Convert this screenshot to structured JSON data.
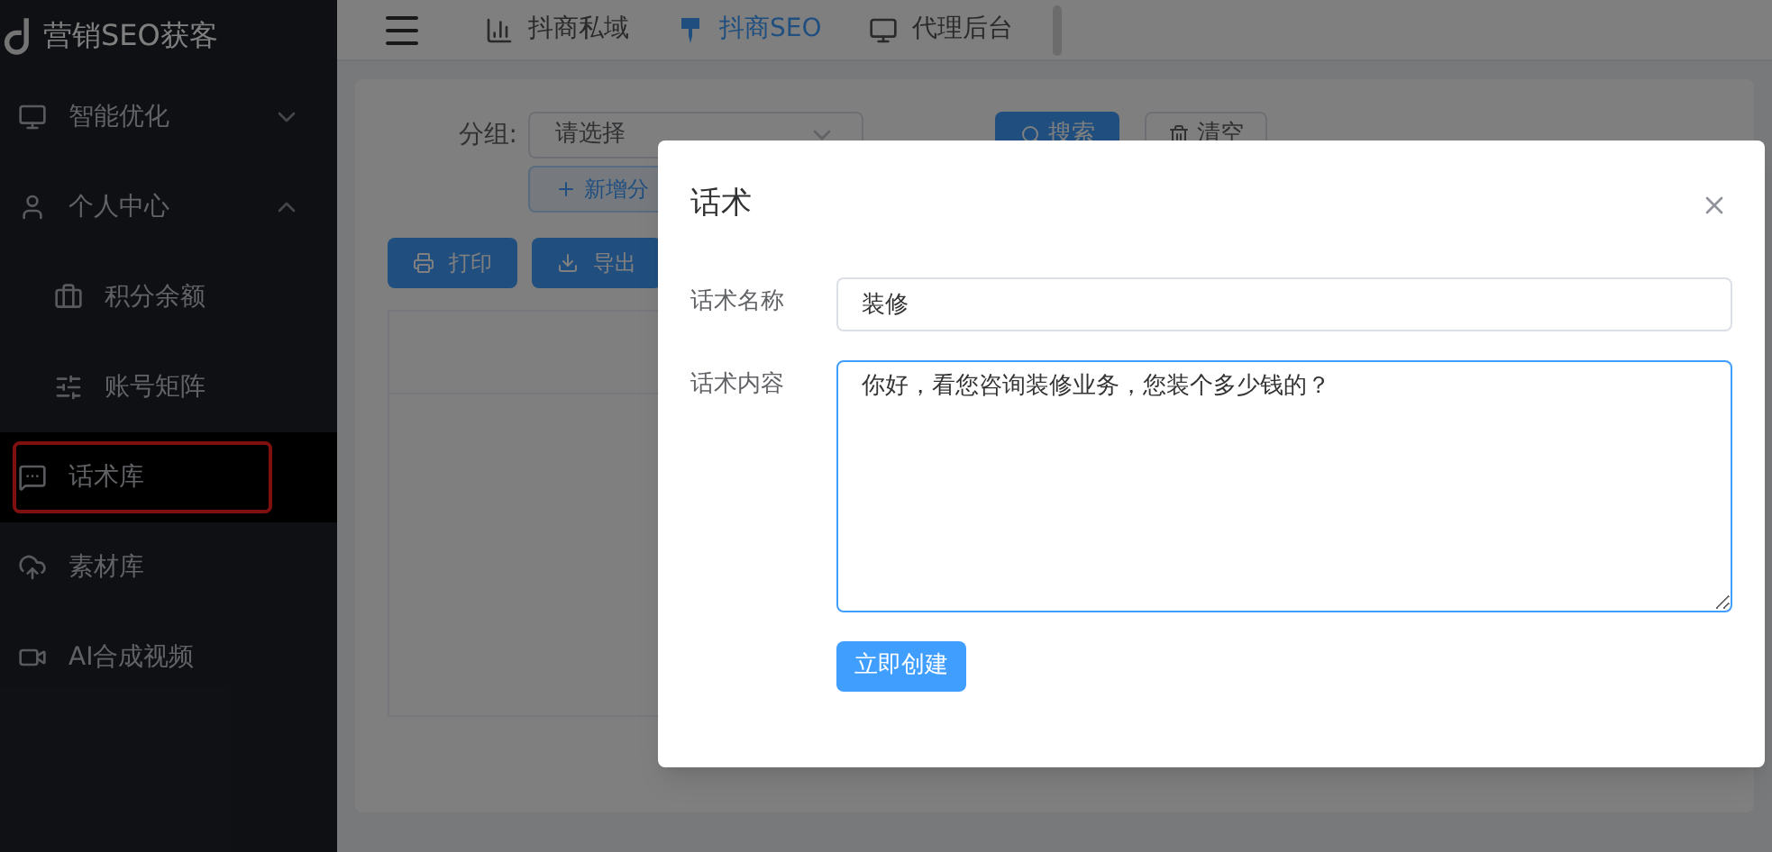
{
  "logo": {
    "text": "营销SEO获客"
  },
  "sidebar": {
    "items": [
      {
        "kind": "group",
        "label": "智能优化",
        "expanded": false
      },
      {
        "kind": "group",
        "label": "个人中心",
        "expanded": true,
        "children": [
          {
            "kind": "link",
            "label": "积分余额",
            "selected": false
          },
          {
            "kind": "link",
            "label": "账号矩阵",
            "selected": false
          }
        ]
      },
      {
        "kind": "link",
        "label": "话术库",
        "selected": true
      },
      {
        "kind": "link",
        "label": "素材库",
        "selected": false
      },
      {
        "kind": "link",
        "label": "AI合成视频",
        "selected": false
      }
    ]
  },
  "tabs": [
    {
      "label": "抖商私域",
      "selected": false
    },
    {
      "label": "抖商SEO",
      "selected": true
    },
    {
      "label": "代理后台",
      "selected": false
    }
  ],
  "filter": {
    "label": "分组:",
    "select": {
      "placeholder": "请选择"
    },
    "add_button": "新增分",
    "search_button": "搜索",
    "clear_button": "清空"
  },
  "toolbar": [
    {
      "kind": "print",
      "label": "打印"
    },
    {
      "kind": "export",
      "label": "导出"
    }
  ],
  "dialog": {
    "title": "话术",
    "fields": [
      {
        "kind": "input",
        "label": "话术名称",
        "value": "装修",
        "focused": false
      },
      {
        "kind": "textarea",
        "label": "话术内容",
        "value": "你好，看您咨询装修业务，您装个多少钱的？",
        "focused": true
      }
    ],
    "submit": "立即创建"
  }
}
